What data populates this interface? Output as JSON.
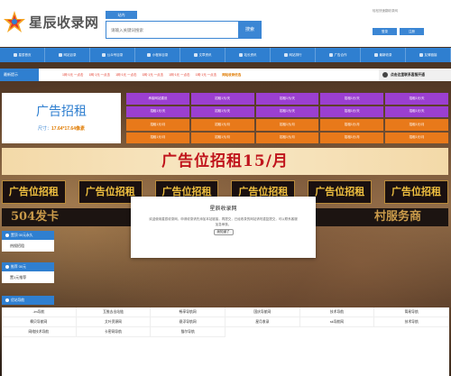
{
  "header": {
    "logo_text": "星辰收录网",
    "search_tab": "站内",
    "search_placeholder": "请输入关键词搜索",
    "search_button": "搜索",
    "top_note": "轻松快速翻收录网",
    "login_label": "登录",
    "register_label": "注册"
  },
  "nav": {
    "items": [
      "星辰首页",
      "网站目录",
      "公众号目录",
      "小程序目录",
      "文章资讯",
      "站长资讯",
      "网站排行",
      "广告合作",
      "最新收录",
      "友情链接"
    ]
  },
  "notice": {
    "title": "最新提示",
    "items": [
      {
        "text": "1网·1元 一点击",
        "style": "red"
      },
      {
        "text": "1网·1元 一点击",
        "style": "red"
      },
      {
        "text": "1网·1元 一点击",
        "style": "red"
      },
      {
        "text": "1网·1元 一点击",
        "style": "red"
      },
      {
        "text": "1网·1元 一点击",
        "style": "red"
      },
      {
        "text": "1网·1元 一点击",
        "style": "red"
      },
      {
        "text": "网站收录优选",
        "style": "orange"
      }
    ],
    "right_text": "点击这里联系客服开通"
  },
  "ad_left": {
    "title": "广告招租",
    "size_label": "尺寸：",
    "size_value": "17.64*17.64像素"
  },
  "ad_grid": {
    "cells": [
      {
        "text": "承接网站建设",
        "color": "purple"
      },
      {
        "text": "招租1元/天",
        "color": "purple"
      },
      {
        "text": "招租1元/天",
        "color": "purple"
      },
      {
        "text": "招租1元/天",
        "color": "purple"
      },
      {
        "text": "招租1元/天",
        "color": "purple"
      },
      {
        "text": "招租1元/天",
        "color": "purple"
      },
      {
        "text": "招租1元/天",
        "color": "purple"
      },
      {
        "text": "招租1元/天",
        "color": "purple"
      },
      {
        "text": "招租1元/天",
        "color": "purple"
      },
      {
        "text": "招租1元/天",
        "color": "purple"
      },
      {
        "text": "招租1元/月",
        "color": "orange"
      },
      {
        "text": "招租1元/月",
        "color": "orange"
      },
      {
        "text": "招租1元/月",
        "color": "orange"
      },
      {
        "text": "招租1元/月",
        "color": "orange"
      },
      {
        "text": "招租1元/月",
        "color": "orange"
      },
      {
        "text": "招租1元/月",
        "color": "orange"
      },
      {
        "text": "招租1元/月",
        "color": "orange"
      },
      {
        "text": "招租1元/月",
        "color": "orange"
      },
      {
        "text": "招租1元/月",
        "color": "orange"
      },
      {
        "text": "招租1元/月",
        "color": "orange"
      }
    ]
  },
  "banner": {
    "text": "广告位招租15/月"
  },
  "tiles": [
    "广告位招租",
    "广告位招租",
    "广告位招租",
    "广告位招租",
    "广告位招租",
    "广告位招租"
  ],
  "strip": {
    "left": "504发卡",
    "right": "村服务商"
  },
  "sections": {
    "s1": {
      "title": "置顶·30元永久",
      "body": "热搜招租"
    },
    "s2": {
      "title": "推荐·30元",
      "body": "置1元推荐"
    },
    "s3": {
      "title": "优站导航"
    }
  },
  "modal": {
    "title": "星辰收录网",
    "body": "欢迎使用星辰收录网，申请收录请先添加本站链接，再提交，已经收录的网站请勿重复提交，可以联系客服加急审核。",
    "close_label": "我知道了"
  },
  "links": [
    "-im导航",
    "互推去出站链",
    "畅享导航网",
    "国庆导航网",
    "技术导航",
    "简易导航",
    "椰贝导航网",
    "艾叶资源网",
    "悬浮导航网",
    "星月收录",
    "sk导航网",
    "技术导航",
    "网络技术导航",
    "卡密网导航",
    "猫尔导航"
  ],
  "colors": {
    "accent": "#2f7fd0",
    "purple": "#9b3fd0",
    "orange": "#e8791a",
    "red": "#c0141c"
  }
}
